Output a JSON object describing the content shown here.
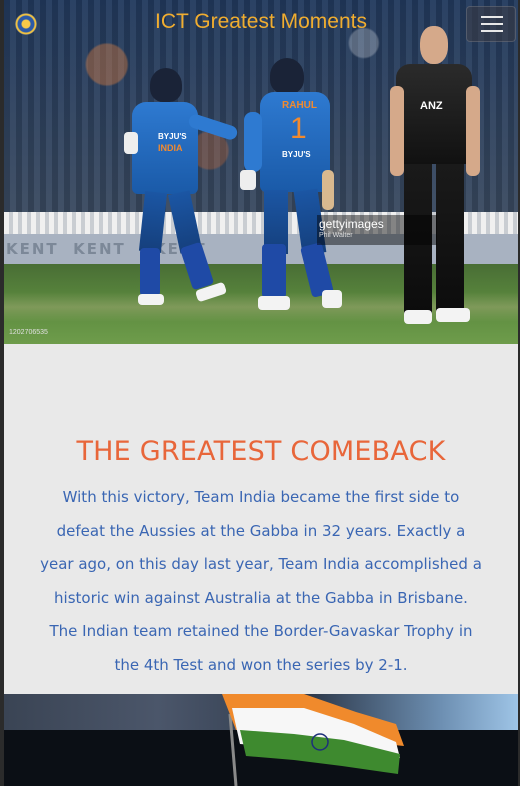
{
  "header": {
    "title": "ICT Greatest Moments",
    "logo_icon": "bcci-logo-icon",
    "menu_icon": "hamburger-menu-icon"
  },
  "hero": {
    "watermark_brand": "gettyimages",
    "watermark_credit": "Phil Walter",
    "photo_id": "1202706535",
    "jersey_name": "RAHUL",
    "jersey_number": "1",
    "sponsor": "BYJU'S",
    "team": "INDIA",
    "opponent_sponsor": "ANZ"
  },
  "section": {
    "heading": "THE GREATEST COMEBACK",
    "body": "With this victory, Team India became the first side to defeat the Aussies at the Gabba in 32 years. Exactly a year ago, on this day last year, Team India accomplished a historic win against Australia at the Gabba in Brisbane. The Indian team retained the Border-Gavaskar Trophy in the 4th Test and won the series by 2-1."
  },
  "colors": {
    "title": "#f0ad30",
    "heading": "#e8663a",
    "body": "#3a66b3",
    "background": "#e9e9e9"
  }
}
